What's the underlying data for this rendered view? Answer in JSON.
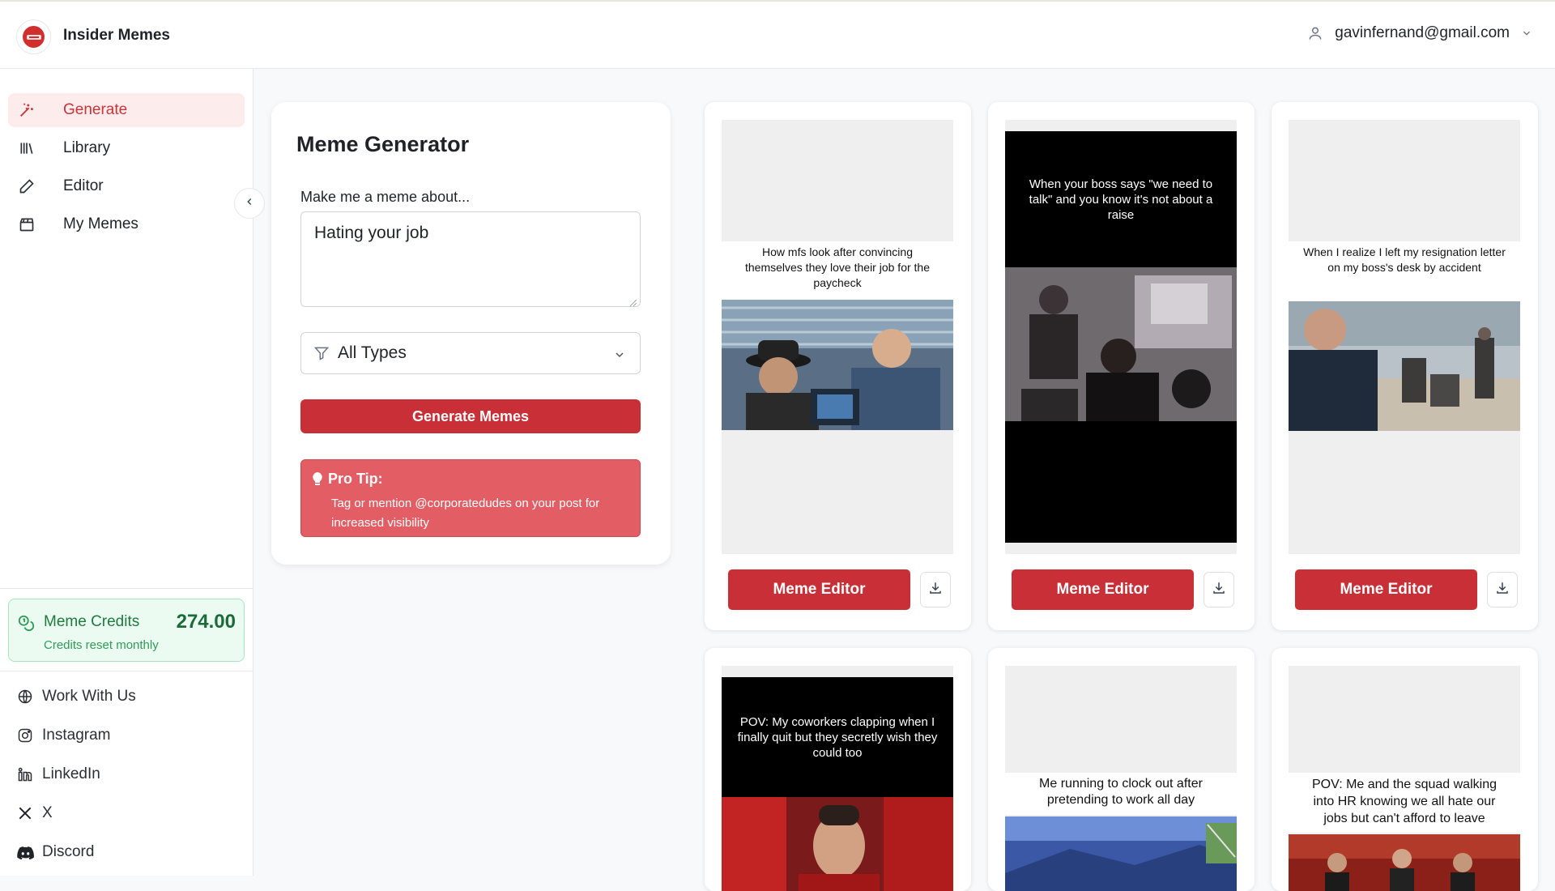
{
  "app": {
    "title": "Insider Memes",
    "logo_text": "Insider Memes"
  },
  "user": {
    "email": "gavinfernand@gmail.com",
    "icon": "user-icon"
  },
  "sidebar": {
    "items": [
      {
        "label": "Generate",
        "icon": "magic-wand-icon",
        "active": true
      },
      {
        "label": "Library",
        "icon": "library-icon",
        "active": false
      },
      {
        "label": "Editor",
        "icon": "pencil-icon",
        "active": false
      },
      {
        "label": "My Memes",
        "icon": "clapperboard-icon",
        "active": false
      }
    ],
    "credits": {
      "label": "Meme Credits",
      "value": "274.00",
      "sub": "Credits reset monthly"
    },
    "links": [
      {
        "label": "Work With Us",
        "icon": "globe-icon"
      },
      {
        "label": "Instagram",
        "icon": "instagram-icon"
      },
      {
        "label": "LinkedIn",
        "icon": "linkedin-icon"
      },
      {
        "label": "X",
        "icon": "x-icon"
      },
      {
        "label": "Discord",
        "icon": "discord-icon"
      }
    ]
  },
  "generator": {
    "title": "Meme Generator",
    "prompt_label": "Make me a meme about...",
    "prompt_value": "Hating your job",
    "type_select": "All Types",
    "generate_label": "Generate Memes",
    "tip_title": "Pro Tip:",
    "tip_text": "Tag or mention @corporatedudes on your post for increased visibility"
  },
  "memes": [
    {
      "caption": "How mfs look after convincing themselves they love their job for the paycheck",
      "editor_label": "Meme Editor"
    },
    {
      "caption": "When your boss says \"we need to talk\" and you know it's not about a raise",
      "editor_label": "Meme Editor"
    },
    {
      "caption": "When I realize I left my resignation letter on my boss's desk by accident",
      "editor_label": "Meme Editor"
    },
    {
      "caption": "POV: My coworkers clapping when I finally quit but they secretly wish they could too"
    },
    {
      "caption": "Me running to clock out after pretending to work all day"
    },
    {
      "caption": "POV: Me and the squad walking into HR knowing we all hate our jobs but can't afford to leave"
    }
  ],
  "colors": {
    "accent": "#c92f37",
    "accent_light": "#fdecec",
    "tip_bg": "#e35d64",
    "credits_bg": "#ecfbf1",
    "credits_text": "#1a6b38"
  }
}
